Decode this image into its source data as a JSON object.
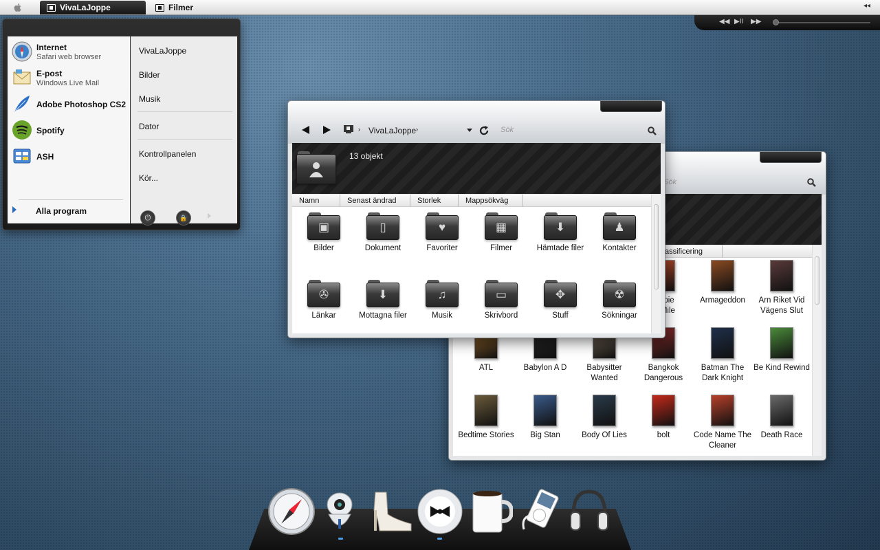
{
  "topbar": {
    "tabs": [
      {
        "label": "VivaLaJoppe",
        "icon": "user-window-icon",
        "active": true
      },
      {
        "label": "Filmer",
        "icon": "film-window-icon",
        "active": false
      }
    ],
    "right_control": "◂◂"
  },
  "media": {
    "prev": "◀◀",
    "playpause": "▶II",
    "next": "▶▶"
  },
  "start_menu": {
    "apps": [
      {
        "name": "Internet",
        "sub": "Safari web browser",
        "icon": "safari-icon"
      },
      {
        "name": "E-post",
        "sub": "Windows Live Mail",
        "icon": "mail-icon"
      },
      {
        "name": "Adobe Photoshop CS2",
        "sub": "",
        "icon": "feather-icon"
      },
      {
        "name": "Spotify",
        "sub": "",
        "icon": "spotify-icon"
      },
      {
        "name": "ASH",
        "sub": "",
        "icon": "ash-icon"
      }
    ],
    "all_programs": "Alla program",
    "places": [
      "VivaLaJoppe",
      "Bilder",
      "Musik",
      "Dator",
      "Kontrollpanelen",
      "Kör..."
    ],
    "power_glyph": "⏻",
    "lock_glyph": "🔒"
  },
  "explorer": {
    "breadcrumb": "VivaLaJoppe",
    "search_placeholder": "Sök",
    "item_count": "13 objekt",
    "columns": [
      "Namn",
      "Senast ändrad",
      "Storlek",
      "Mappsökväg"
    ],
    "folders": [
      {
        "label": "Bilder",
        "icon": "pictures-folder-icon",
        "glyph": "▣"
      },
      {
        "label": "Dokument",
        "icon": "documents-folder-icon",
        "glyph": "▯"
      },
      {
        "label": "Favoriter",
        "icon": "favorites-folder-icon",
        "glyph": "♥"
      },
      {
        "label": "Filmer",
        "icon": "movies-folder-icon",
        "glyph": "▦"
      },
      {
        "label": "Hämtade filer",
        "icon": "downloads-folder-icon",
        "glyph": "⬇"
      },
      {
        "label": "Kontakter",
        "icon": "contacts-folder-icon",
        "glyph": "♟"
      },
      {
        "label": "Länkar",
        "icon": "links-folder-icon",
        "glyph": "✇"
      },
      {
        "label": "Mottagna filer",
        "icon": "received-files-folder-icon",
        "glyph": "⬇"
      },
      {
        "label": "Musik",
        "icon": "music-folder-icon",
        "glyph": "♫"
      },
      {
        "label": "Skrivbord",
        "icon": "desktop-folder-icon",
        "glyph": "▭"
      },
      {
        "label": "Stuff",
        "icon": "dropbox-folder-icon",
        "glyph": "✥"
      },
      {
        "label": "Sökningar",
        "icon": "searches-folder-icon",
        "glyph": "☢"
      }
    ]
  },
  "movies_window": {
    "search_placeholder": "Sök",
    "column_partial": "assificering",
    "movies": [
      {
        "title": "an pie\net Mile",
        "color": "#b54a2a"
      },
      {
        "title": "Armageddon",
        "color": "#8a4a22"
      },
      {
        "title": "Arn Riket Vid Vägens Slut",
        "color": "#5a3a3a"
      },
      {
        "title": "ATL",
        "color": "#9a6a2a"
      },
      {
        "title": "Babylon A D",
        "color": "#2a2a2a"
      },
      {
        "title": "Babysitter Wanted",
        "color": "#7a6a5a"
      },
      {
        "title": "Bangkok Dangerous",
        "color": "#8a2a2a"
      },
      {
        "title": "Batman The Dark Knight",
        "color": "#1f2f4a"
      },
      {
        "title": "Be Kind Rewind",
        "color": "#4a8a3a"
      },
      {
        "title": "Bedtime Stories",
        "color": "#6a5a3a"
      },
      {
        "title": "Big Stan",
        "color": "#3a5a8a"
      },
      {
        "title": "Body Of Lies",
        "color": "#2a3a4a"
      },
      {
        "title": "bolt",
        "color": "#c42a1a"
      },
      {
        "title": "Code Name The Cleaner",
        "color": "#b8402a"
      },
      {
        "title": "Death Race",
        "color": "#6a6a6a"
      }
    ]
  },
  "dock": [
    {
      "name": "safari-dock-icon",
      "running": false
    },
    {
      "name": "robot-dock-icon",
      "running": true
    },
    {
      "name": "shoe-dock-icon",
      "running": false
    },
    {
      "name": "tuxedo-disc-dock-icon",
      "running": true
    },
    {
      "name": "coffee-mug-dock-icon",
      "running": false
    },
    {
      "name": "ipod-dock-icon",
      "running": false
    },
    {
      "name": "headphones-dock-icon",
      "running": false
    }
  ],
  "colors": {
    "accent": "#4b9be8",
    "dark": "#1a1a1a"
  }
}
